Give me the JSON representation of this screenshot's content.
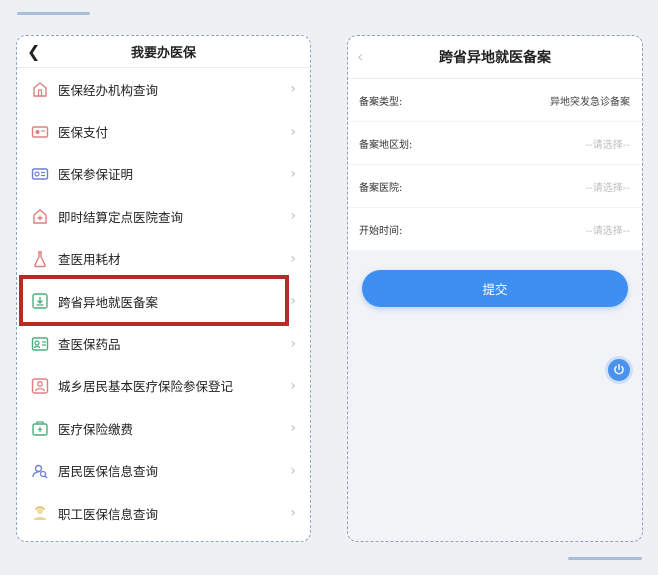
{
  "left": {
    "title": "我要办医保",
    "items": [
      {
        "label": "医保经办机构查询",
        "icon": "building-icon",
        "color": "#e07e7e"
      },
      {
        "label": "医保支付",
        "icon": "card-icon",
        "color": "#e07e7e"
      },
      {
        "label": "医保参保证明",
        "icon": "id-card-icon",
        "color": "#6b7fd8"
      },
      {
        "label": "即时结算定点医院查询",
        "icon": "hospital-icon",
        "color": "#e07e7e"
      },
      {
        "label": "查医用耗材",
        "icon": "flask-icon",
        "color": "#e07e7e"
      },
      {
        "label": "跨省异地就医备案",
        "icon": "record-icon",
        "color": "#4caf7a"
      },
      {
        "label": "查医保药品",
        "icon": "pill-icon",
        "color": "#4caf7a"
      },
      {
        "label": "城乡居民基本医疗保险参保登记",
        "icon": "person-icon",
        "color": "#e07e7e"
      },
      {
        "label": "医疗保险缴费",
        "icon": "wallet-icon",
        "color": "#4caf7a"
      },
      {
        "label": "居民医保信息查询",
        "icon": "user-search-icon",
        "color": "#6b7fd8"
      },
      {
        "label": "职工医保信息查询",
        "icon": "worker-icon",
        "color": "#e0b84a"
      }
    ],
    "highlight_color": "#b32c25"
  },
  "right": {
    "title": "跨省异地就医备案",
    "fields": [
      {
        "label": "备案类型:",
        "value": "异地突发急诊备案",
        "placeholder": false
      },
      {
        "label": "备案地区划:",
        "value": "--请选择--",
        "placeholder": true
      },
      {
        "label": "备案医院:",
        "value": "--请选择--",
        "placeholder": true
      },
      {
        "label": "开始时间:",
        "value": "--请选择--",
        "placeholder": true
      }
    ],
    "submit_label": "提交",
    "accent": "#3f8ef2"
  }
}
